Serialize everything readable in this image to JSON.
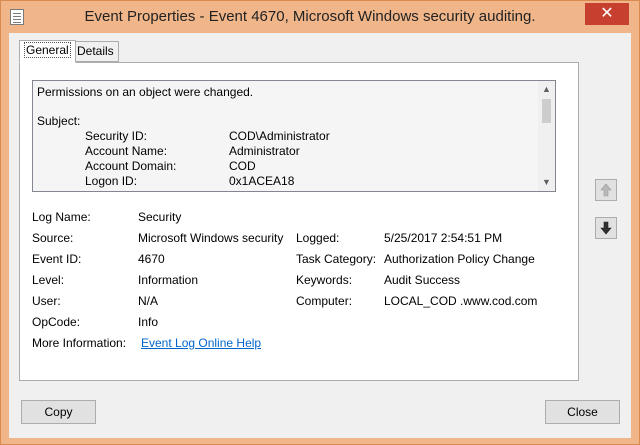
{
  "window": {
    "title": "Event Properties - Event 4670, Microsoft Windows security auditing.",
    "close_glyph": "✕"
  },
  "tabs": [
    {
      "label": "General",
      "active": true
    },
    {
      "label": "Details",
      "active": false
    }
  ],
  "description": {
    "headline": "Permissions on an object were changed.",
    "section": "Subject:",
    "fields": [
      {
        "key": "Security ID:",
        "value": "COD\\Administrator"
      },
      {
        "key": "Account Name:",
        "value": "Administrator"
      },
      {
        "key": "Account Domain:",
        "value": "COD"
      },
      {
        "key": "Logon ID:",
        "value": "0x1ACEA18"
      }
    ],
    "scroll_up_glyph": "▲",
    "scroll_down_glyph": "▼"
  },
  "props": {
    "log_name": {
      "label": "Log Name:",
      "value": "Security"
    },
    "source": {
      "label": "Source:",
      "value": "Microsoft Windows security"
    },
    "logged": {
      "label": "Logged:",
      "value": "5/25/2017 2:54:51 PM"
    },
    "event_id": {
      "label": "Event ID:",
      "value": "4670"
    },
    "task_category": {
      "label": "Task Category:",
      "value": "Authorization Policy Change"
    },
    "level": {
      "label": "Level:",
      "value": "Information"
    },
    "keywords": {
      "label": "Keywords:",
      "value": "Audit Success"
    },
    "user": {
      "label": "User:",
      "value": "N/A"
    },
    "computer": {
      "label": "Computer:",
      "value": "LOCAL_COD .www.cod.com"
    },
    "opcode": {
      "label": "OpCode:",
      "value": "Info"
    },
    "more_info": {
      "label": "More Information:",
      "link": "Event Log Online Help"
    }
  },
  "buttons": {
    "copy": "Copy",
    "close": "Close"
  },
  "icons": {
    "app": "event-log-icon",
    "previous": "up-arrow-icon",
    "next": "down-arrow-icon"
  },
  "colors": {
    "titlebar": "#f0b68a",
    "close_button": "#c7402f",
    "link": "#0066cc"
  }
}
